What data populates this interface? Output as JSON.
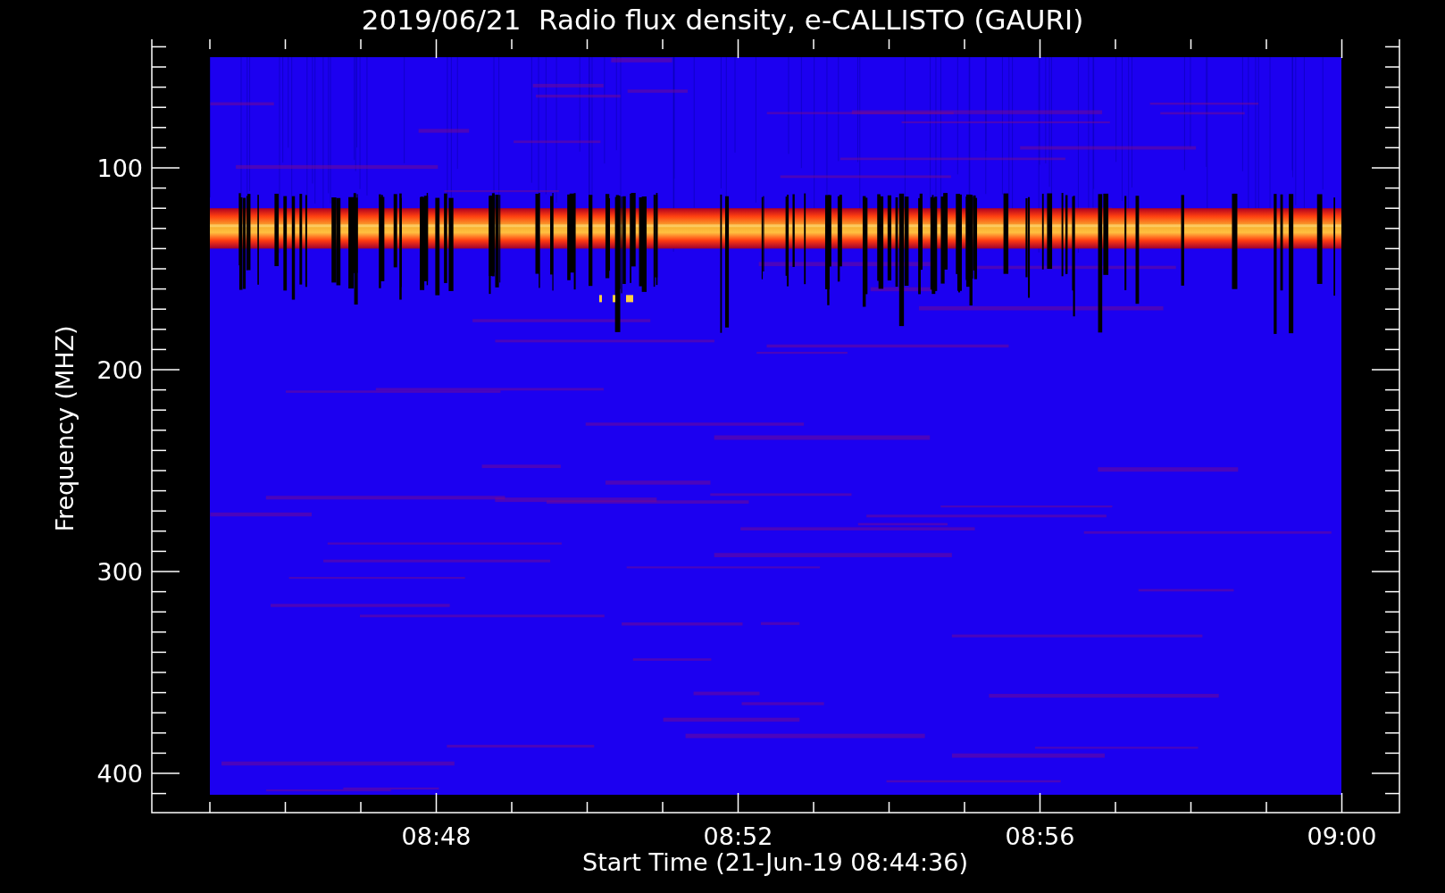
{
  "plot": {
    "title": "2019/06/21  Radio flux density, e-CALLISTO (GAURI)",
    "ylabel": "Frequency (MHZ)",
    "xlabel": "Start Time (21-Jun-19 08:44:36)",
    "yticks": [
      "100",
      "200",
      "300",
      "400"
    ],
    "xticks": [
      "08:48",
      "08:52",
      "08:56",
      "09:00"
    ]
  }
}
